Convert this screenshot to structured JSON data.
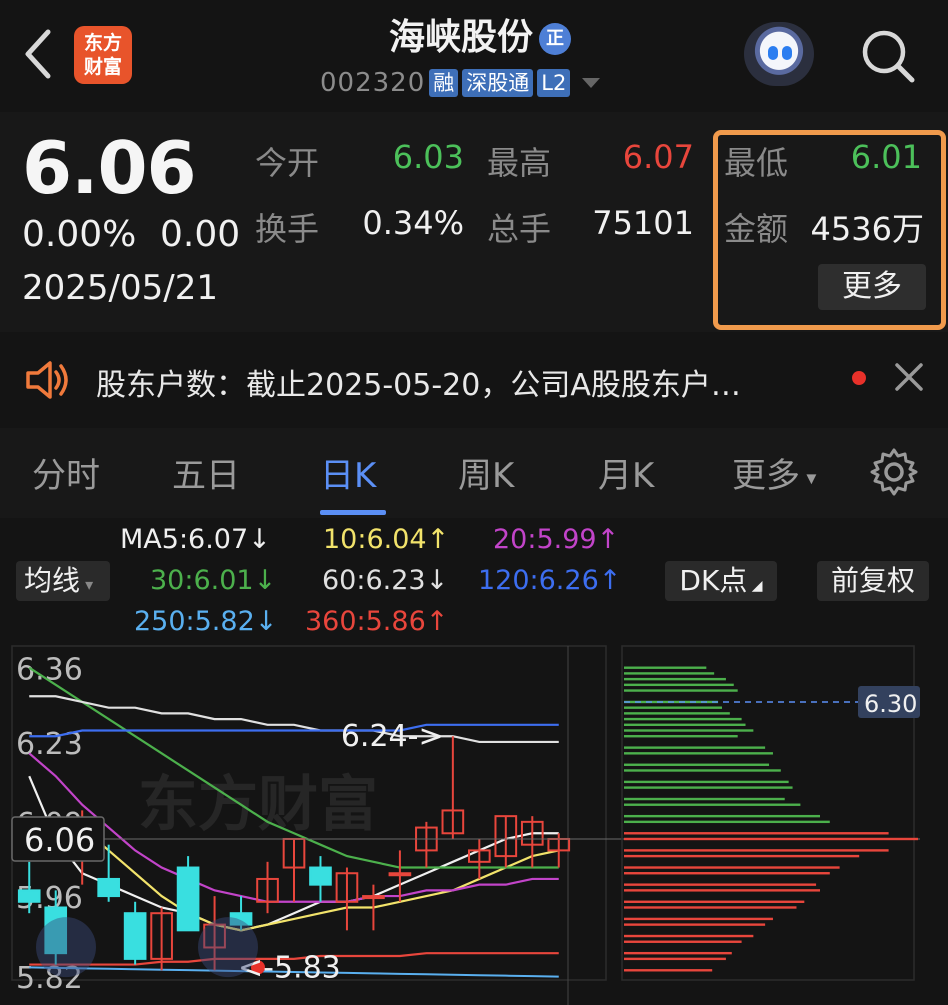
{
  "header": {
    "brand": "东方\n财富",
    "brand_line1": "东方",
    "brand_line2": "财富",
    "stock_name": "海峡股份",
    "name_badge": "正",
    "code": "002320",
    "tags": [
      "融",
      "深股通",
      "L2"
    ]
  },
  "quote": {
    "price": "6.06",
    "change_pct": "0.00%",
    "change": "0.00",
    "date": "2025/05/21",
    "open_label": "今开",
    "open": "6.03",
    "high_label": "最高",
    "high": "6.07",
    "low_label": "最低",
    "low": "6.01",
    "turnover_label": "换手",
    "turnover": "0.34%",
    "volume_label": "总手",
    "volume": "75101",
    "amount_label": "金额",
    "amount": "4536万",
    "more_label": "更多"
  },
  "notice": {
    "text": "股东户数：截止2025-05-20，公司A股股东户…"
  },
  "tabs": {
    "items": [
      "分时",
      "五日",
      "日K",
      "周K",
      "月K",
      "更多"
    ],
    "active": "日K"
  },
  "ma_legend": {
    "toggle": "均线",
    "dk_label": "DK点",
    "adjust_label": "前复权",
    "items": [
      {
        "text": "MA5:6.07",
        "arrow": "↓",
        "color": "#f0f0f0"
      },
      {
        "text": "10:6.04",
        "arrow": "↑",
        "color": "#f2e36b"
      },
      {
        "text": "20:5.99",
        "arrow": "↑",
        "color": "#c244c9"
      },
      {
        "text": "30:6.01",
        "arrow": "↓",
        "color": "#4cb04c"
      },
      {
        "text": "60:6.23",
        "arrow": "↓",
        "color": "#e0e0e0"
      },
      {
        "text": "120:6.26",
        "arrow": "↑",
        "color": "#3d6ef0"
      },
      {
        "text": "250:5.82",
        "arrow": "↓",
        "color": "#5ab0f0"
      },
      {
        "text": "360:5.86",
        "arrow": "↑",
        "color": "#e8463c"
      }
    ]
  },
  "chart_data": {
    "type": "candlestick",
    "y_ticks": [
      "6.36",
      "6.23",
      "6.09",
      "5.96",
      "5.82"
    ],
    "current_price_label": "6.06",
    "high_annotation": "6.24->",
    "low_annotation": "<-5.83",
    "watermark": "东方财富",
    "profile_price_label": "6.30",
    "ylim": [
      5.82,
      6.37
    ],
    "candles": [
      {
        "o": 5.97,
        "h": 6.02,
        "l": 5.93,
        "c": 5.95
      },
      {
        "o": 5.94,
        "h": 5.97,
        "l": 5.84,
        "c": 5.86
      },
      {
        "o": 6.04,
        "h": 6.11,
        "l": 5.98,
        "c": 6.07
      },
      {
        "o": 5.99,
        "h": 6.05,
        "l": 5.95,
        "c": 5.96
      },
      {
        "o": 5.93,
        "h": 5.95,
        "l": 5.84,
        "c": 5.85
      },
      {
        "o": 5.85,
        "h": 5.94,
        "l": 5.83,
        "c": 5.93
      },
      {
        "o": 6.01,
        "h": 6.03,
        "l": 5.9,
        "c": 5.9
      },
      {
        "o": 5.87,
        "h": 5.96,
        "l": 5.83,
        "c": 5.91
      },
      {
        "o": 5.93,
        "h": 5.96,
        "l": 5.9,
        "c": 5.91
      },
      {
        "o": 5.95,
        "h": 6.02,
        "l": 5.93,
        "c": 5.99
      },
      {
        "o": 6.01,
        "h": 6.06,
        "l": 5.95,
        "c": 6.06
      },
      {
        "o": 6.01,
        "h": 6.03,
        "l": 5.95,
        "c": 5.98
      },
      {
        "o": 5.95,
        "h": 6.01,
        "l": 5.9,
        "c": 6.0
      },
      {
        "o": 5.96,
        "h": 5.98,
        "l": 5.9,
        "c": 5.96
      },
      {
        "o": 6.0,
        "h": 6.04,
        "l": 5.95,
        "c": 6.0
      },
      {
        "o": 6.04,
        "h": 6.09,
        "l": 6.01,
        "c": 6.08
      },
      {
        "o": 6.07,
        "h": 6.24,
        "l": 6.06,
        "c": 6.11
      },
      {
        "o": 6.02,
        "h": 6.06,
        "l": 5.99,
        "c": 6.04
      },
      {
        "o": 6.03,
        "h": 6.1,
        "l": 6.01,
        "c": 6.1
      },
      {
        "o": 6.05,
        "h": 6.1,
        "l": 6.01,
        "c": 6.09
      },
      {
        "o": 6.04,
        "h": 6.07,
        "l": 6.01,
        "c": 6.06
      }
    ],
    "ma_lines": [
      {
        "name": "MA5",
        "color": "#f0f0f0",
        "values": [
          6.17,
          6.06,
          6.0,
          5.98,
          5.96,
          5.94,
          5.93,
          5.91,
          5.9,
          5.91,
          5.93,
          5.95,
          5.95,
          5.96,
          5.98,
          6.0,
          6.02,
          6.04,
          6.06,
          6.07,
          6.07
        ]
      },
      {
        "name": "MA10",
        "color": "#f2e36b",
        "values": [
          6.08,
          6.09,
          6.08,
          6.04,
          6.0,
          5.96,
          5.93,
          5.91,
          5.9,
          5.91,
          5.92,
          5.93,
          5.94,
          5.94,
          5.95,
          5.96,
          5.97,
          5.99,
          6.01,
          6.03,
          6.04
        ]
      },
      {
        "name": "MA20",
        "color": "#c244c9",
        "values": [
          6.21,
          6.17,
          6.12,
          6.08,
          6.04,
          6.01,
          5.99,
          5.97,
          5.96,
          5.95,
          5.95,
          5.95,
          5.95,
          5.96,
          5.96,
          5.97,
          5.97,
          5.98,
          5.98,
          5.99,
          5.99
        ]
      },
      {
        "name": "MA30",
        "color": "#4cb04c",
        "values": [
          6.36,
          6.33,
          6.3,
          6.27,
          6.24,
          6.21,
          6.18,
          6.15,
          6.12,
          6.09,
          6.07,
          6.05,
          6.03,
          6.02,
          6.01,
          6.01,
          6.01,
          6.01,
          6.01,
          6.01,
          6.01
        ]
      },
      {
        "name": "MA60",
        "color": "#e0e0e0",
        "values": [
          6.31,
          6.31,
          6.3,
          6.29,
          6.29,
          6.28,
          6.28,
          6.27,
          6.27,
          6.26,
          6.26,
          6.25,
          6.25,
          6.25,
          6.24,
          6.24,
          6.24,
          6.23,
          6.23,
          6.23,
          6.23
        ]
      },
      {
        "name": "MA120",
        "color": "#3d6ef0",
        "values": [
          6.24,
          6.24,
          6.25,
          6.25,
          6.25,
          6.25,
          6.25,
          6.25,
          6.25,
          6.25,
          6.25,
          6.25,
          6.25,
          6.25,
          6.25,
          6.26,
          6.26,
          6.26,
          6.26,
          6.26,
          6.26
        ]
      },
      {
        "name": "MA360",
        "color": "#e8463c",
        "values": [
          5.84,
          5.84,
          5.84,
          5.84,
          5.84,
          5.845,
          5.845,
          5.85,
          5.85,
          5.85,
          5.85,
          5.855,
          5.855,
          5.855,
          5.855,
          5.86,
          5.86,
          5.86,
          5.86,
          5.86,
          5.86
        ]
      }
    ],
    "volume_profile": [
      {
        "price": 6.36,
        "w": 0.42,
        "side": "up"
      },
      {
        "price": 6.35,
        "w": 0.46,
        "side": "up"
      },
      {
        "price": 6.34,
        "w": 0.52,
        "side": "up"
      },
      {
        "price": 6.33,
        "w": 0.56,
        "side": "up"
      },
      {
        "price": 6.32,
        "w": 0.58,
        "side": "up"
      },
      {
        "price": 6.3,
        "w": 0.48,
        "side": "up"
      },
      {
        "price": 6.29,
        "w": 0.5,
        "side": "up"
      },
      {
        "price": 6.28,
        "w": 0.54,
        "side": "up"
      },
      {
        "price": 6.27,
        "w": 0.6,
        "side": "up"
      },
      {
        "price": 6.26,
        "w": 0.62,
        "side": "up"
      },
      {
        "price": 6.25,
        "w": 0.66,
        "side": "up"
      },
      {
        "price": 6.24,
        "w": 0.58,
        "side": "up"
      },
      {
        "price": 6.22,
        "w": 0.72,
        "side": "up"
      },
      {
        "price": 6.21,
        "w": 0.76,
        "side": "up"
      },
      {
        "price": 6.19,
        "w": 0.74,
        "side": "up"
      },
      {
        "price": 6.18,
        "w": 0.8,
        "side": "up"
      },
      {
        "price": 6.16,
        "w": 0.84,
        "side": "up"
      },
      {
        "price": 6.15,
        "w": 0.86,
        "side": "up"
      },
      {
        "price": 6.13,
        "w": 0.82,
        "side": "up"
      },
      {
        "price": 6.12,
        "w": 0.9,
        "side": "up"
      },
      {
        "price": 6.1,
        "w": 1.0,
        "side": "up"
      },
      {
        "price": 6.09,
        "w": 1.05,
        "side": "up"
      },
      {
        "price": 6.07,
        "w": 1.35,
        "side": "down"
      },
      {
        "price": 6.06,
        "w": 1.5,
        "side": "down"
      },
      {
        "price": 6.04,
        "w": 1.35,
        "side": "down"
      },
      {
        "price": 6.03,
        "w": 1.2,
        "side": "down"
      },
      {
        "price": 6.01,
        "w": 1.1,
        "side": "down"
      },
      {
        "price": 6.0,
        "w": 1.05,
        "side": "down"
      },
      {
        "price": 5.98,
        "w": 0.98,
        "side": "down"
      },
      {
        "price": 5.97,
        "w": 1.0,
        "side": "down"
      },
      {
        "price": 5.95,
        "w": 0.92,
        "side": "down"
      },
      {
        "price": 5.94,
        "w": 0.88,
        "side": "down"
      },
      {
        "price": 5.92,
        "w": 0.76,
        "side": "down"
      },
      {
        "price": 5.91,
        "w": 0.72,
        "side": "down"
      },
      {
        "price": 5.89,
        "w": 0.66,
        "side": "down"
      },
      {
        "price": 5.88,
        "w": 0.6,
        "side": "down"
      },
      {
        "price": 5.86,
        "w": 0.55,
        "side": "down"
      },
      {
        "price": 5.85,
        "w": 0.52,
        "side": "down"
      },
      {
        "price": 5.83,
        "w": 0.45,
        "side": "down"
      }
    ]
  },
  "colors": {
    "up": "#e8463c",
    "down": "#39dfe0",
    "accent": "#5b8ff5",
    "highlight_box": "#f09a4c"
  }
}
